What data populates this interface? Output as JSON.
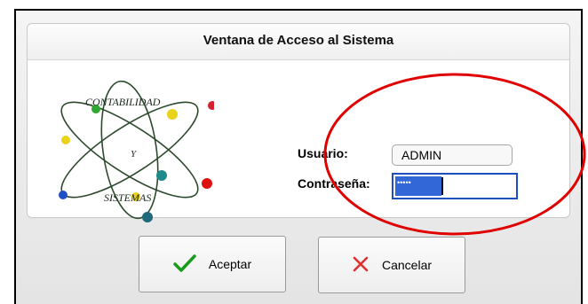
{
  "window": {
    "title": "Ventana de Acceso al Sistema"
  },
  "logo": {
    "line1": "CONTABILIDAD",
    "line2": "Y",
    "line3": "SISTEMAS"
  },
  "form": {
    "user_label": "Usuario:",
    "user_value": "ADMIN",
    "password_label": "Contraseña:",
    "password_mask": "•••••"
  },
  "buttons": {
    "accept_label": "Aceptar",
    "cancel_label": "Cancelar"
  },
  "colors": {
    "accept_icon": "#1a9a1a",
    "cancel_icon": "#e03030",
    "annotation_circle": "#e00000",
    "field_focus_border": "#1b4fbf",
    "selection": "#3267d8"
  },
  "icons": {
    "accept": "checkmark-icon",
    "cancel": "x-icon"
  }
}
